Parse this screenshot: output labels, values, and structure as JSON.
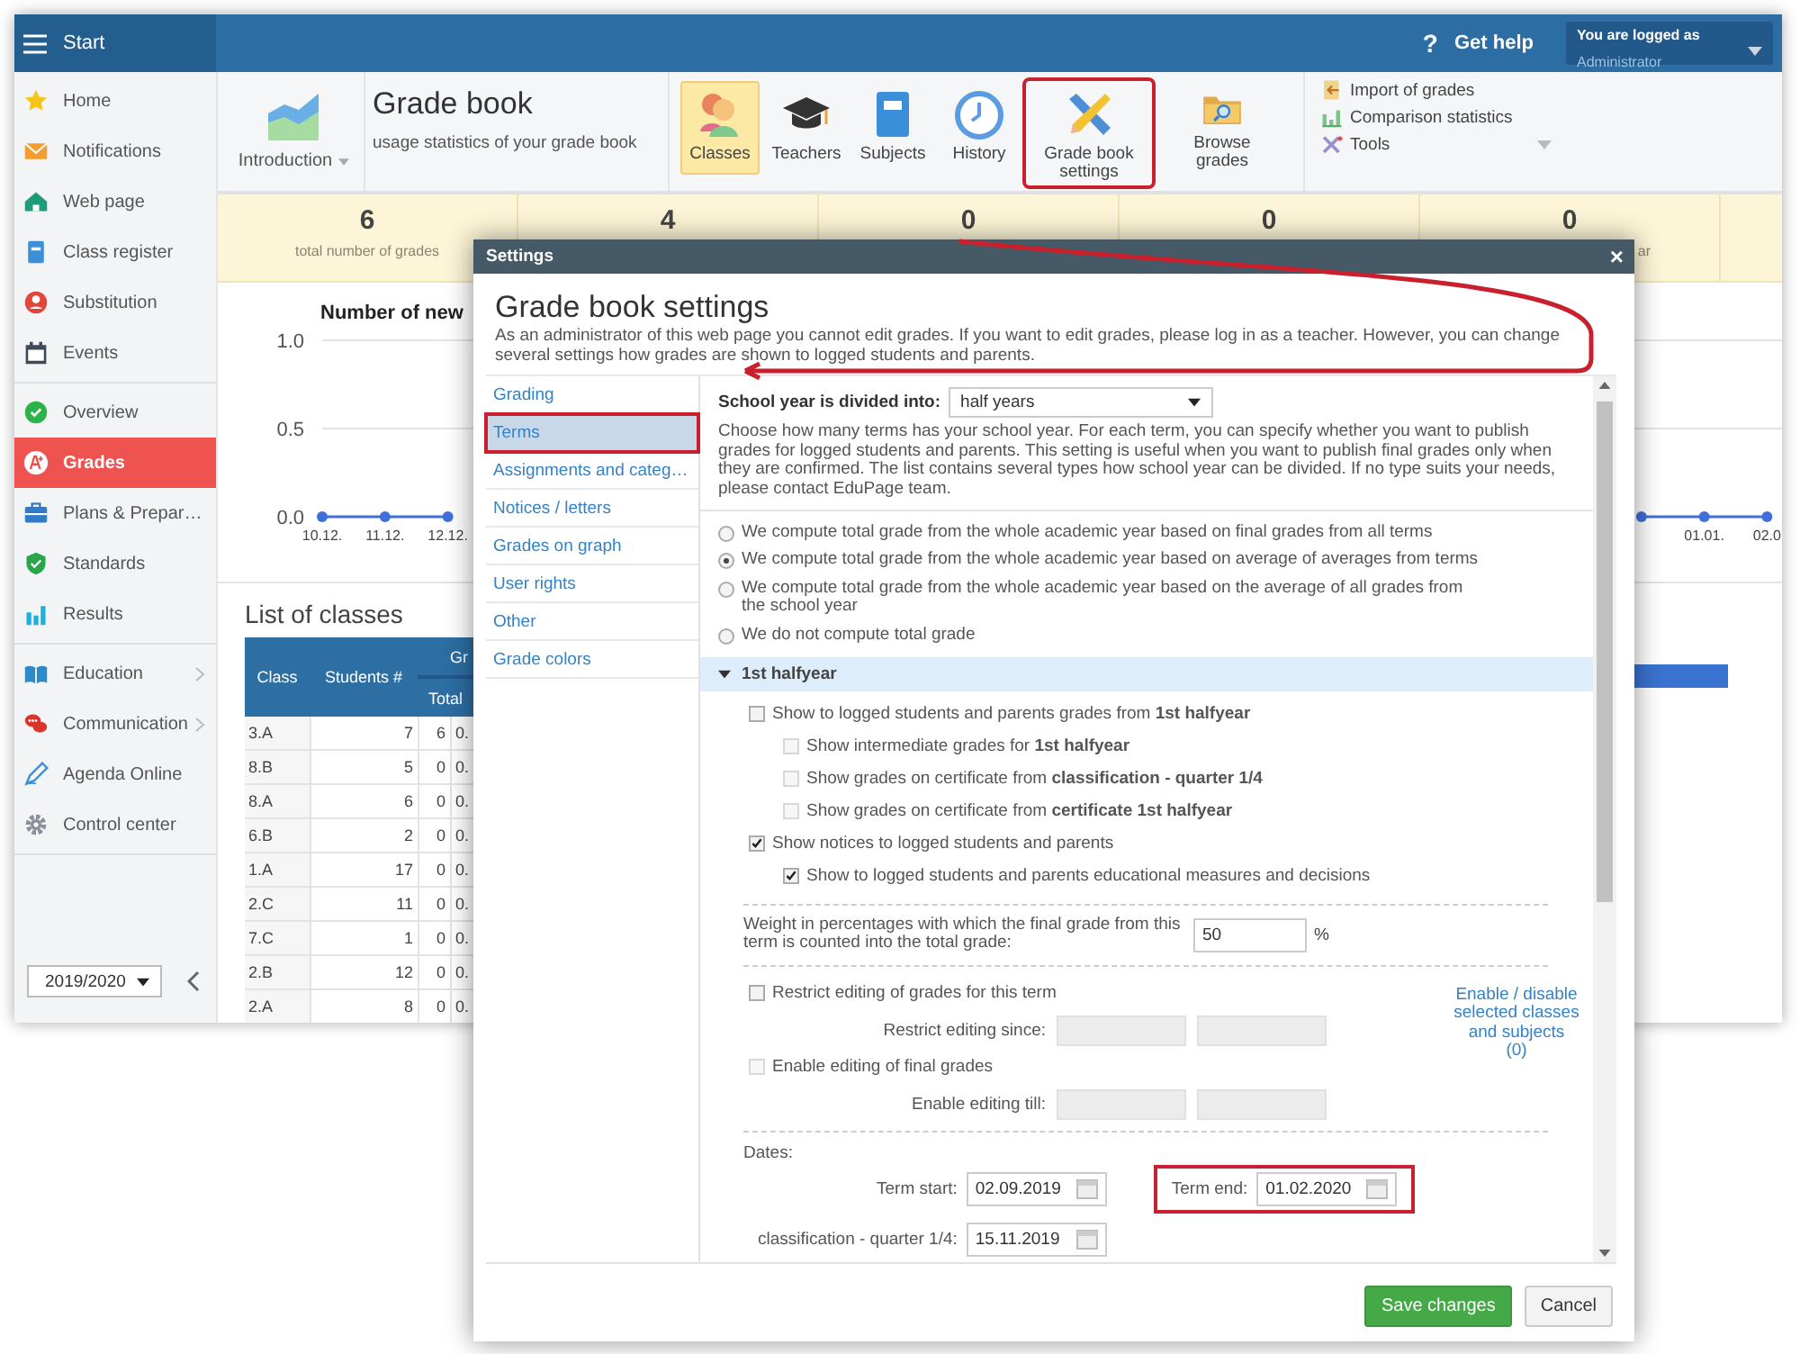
{
  "top_bar": {
    "menu_label": "Start",
    "help_icon": "?",
    "help": "Get help",
    "user": {
      "caption": "You are logged as",
      "name": "Administrator"
    }
  },
  "sidebar": {
    "groups": [
      [
        {
          "label": "Home",
          "selected": false,
          "has_submenu": false
        },
        {
          "label": "Notifications",
          "selected": false,
          "has_submenu": false
        },
        {
          "label": "Web page",
          "selected": false,
          "has_submenu": false
        },
        {
          "label": "Class register",
          "selected": false,
          "has_submenu": false
        },
        {
          "label": "Substitution",
          "selected": false,
          "has_submenu": false
        },
        {
          "label": "Events",
          "selected": false,
          "has_submenu": false
        }
      ],
      [
        {
          "label": "Overview",
          "selected": false,
          "has_submenu": false
        },
        {
          "label": "Grades",
          "selected": true,
          "has_submenu": false
        },
        {
          "label": "Plans & Prepar…",
          "selected": false,
          "has_submenu": false
        },
        {
          "label": "Standards",
          "selected": false,
          "has_submenu": false
        },
        {
          "label": "Results",
          "selected": false,
          "has_submenu": false
        }
      ],
      [
        {
          "label": "Education",
          "selected": false,
          "has_submenu": true
        },
        {
          "label": "Communication",
          "selected": false,
          "has_submenu": true
        },
        {
          "label": "Agenda Online",
          "selected": false,
          "has_submenu": false
        },
        {
          "label": "Control center",
          "selected": false,
          "has_submenu": false
        }
      ]
    ],
    "year": "2019/2020"
  },
  "toolbar": {
    "intro": "Introduction",
    "title": "Grade book",
    "subtitle": "usage statistics of your grade book",
    "buttons": [
      {
        "label": "Classes",
        "selected": true,
        "highlighted": false
      },
      {
        "label": "Teachers",
        "selected": false,
        "highlighted": false
      },
      {
        "label": "Subjects",
        "selected": false,
        "highlighted": false
      },
      {
        "label": "History",
        "selected": false,
        "highlighted": false
      },
      {
        "label": "Grade book settings",
        "selected": false,
        "highlighted": true
      },
      {
        "label": "Browse grades",
        "selected": false,
        "highlighted": false
      }
    ],
    "links": [
      "Import of grades",
      "Comparison statistics",
      "Tools"
    ]
  },
  "stats": [
    {
      "value": "6",
      "label": "total number of grades"
    },
    {
      "value": "4"
    },
    {
      "value": "0"
    },
    {
      "value": "0"
    },
    {
      "value": "0",
      "label": "ar"
    }
  ],
  "chart": {
    "chart_data": {
      "type": "line",
      "title": "Number of new",
      "categories": [
        "10.12.",
        "11.12.",
        "12.12.",
        null,
        null,
        null,
        null,
        null,
        null,
        null,
        null,
        null,
        null,
        null,
        null,
        null,
        null,
        null,
        null,
        null,
        null,
        null,
        "01.01.",
        "02.0"
      ],
      "values": [
        0,
        0,
        0,
        null,
        null,
        null,
        null,
        null,
        null,
        null,
        null,
        null,
        null,
        null,
        null,
        null,
        null,
        null,
        null,
        null,
        null,
        0,
        0,
        0
      ],
      "marker": "circle",
      "yticks": [
        {
          "value": 0,
          "label": "0.0"
        },
        {
          "value": 0.5,
          "label": "0.5"
        },
        {
          "value": 1,
          "label": "1.0"
        }
      ],
      "ylim": [
        0,
        1
      ]
    }
  },
  "class_list": {
    "title": "List of classes",
    "columns": [
      "Class",
      "Students #"
    ],
    "group_header": "Gr",
    "sub_header": "Total",
    "rows": [
      [
        "3.A",
        "7",
        "6",
        "0."
      ],
      [
        "8.B",
        "5",
        "0",
        "0."
      ],
      [
        "8.A",
        "6",
        "0",
        "0."
      ],
      [
        "6.B",
        "2",
        "0",
        "0."
      ],
      [
        "1.A",
        "17",
        "0",
        "0."
      ],
      [
        "2.C",
        "11",
        "0",
        "0."
      ],
      [
        "7.C",
        "1",
        "0",
        "0."
      ],
      [
        "2.B",
        "12",
        "0",
        "0."
      ],
      [
        "2.A",
        "8",
        "0",
        "0."
      ]
    ]
  },
  "dialog": {
    "window_title": "Settings",
    "close": "×",
    "title": "Grade book settings",
    "description": "As an administrator of this web page you cannot edit grades. If you want to edit grades, please log in as a teacher. However, you can change several settings how grades are shown to logged students and parents.",
    "nav": [
      {
        "label": "Grading",
        "selected": false,
        "highlighted": false
      },
      {
        "label": "Terms",
        "selected": true,
        "highlighted": true
      },
      {
        "label": "Assignments and categ…",
        "selected": false,
        "highlighted": false
      },
      {
        "label": "Notices / letters",
        "selected": false,
        "highlighted": false
      },
      {
        "label": "Grades on graph",
        "selected": false,
        "highlighted": false
      },
      {
        "label": "User rights",
        "selected": false,
        "highlighted": false
      },
      {
        "label": "Other",
        "selected": false,
        "highlighted": false
      },
      {
        "label": "Grade colors",
        "selected": false,
        "highlighted": false
      }
    ],
    "division_label": "School year is divided into:",
    "division_value": "half years",
    "division_help": "Choose how many terms has your school year. For each term, you can specify whether you want to publish grades for logged students and parents. This setting is useful when you want to publish final grades only when they are confirmed. The list contains several types how school year can be divided. If no type suits your needs, please contact EduPage team.",
    "total_grade_options": [
      {
        "label": "We compute total grade from the whole academic year based on final grades from all terms",
        "selected": false
      },
      {
        "label": "We compute total grade from the whole academic year based on average of averages from terms",
        "selected": true
      },
      {
        "label": "We compute total grade from the whole academic year based on the average of all grades from the school year",
        "selected": false
      },
      {
        "label": "We do not compute total grade",
        "selected": false
      }
    ],
    "term": {
      "title": "1st halfyear",
      "expanded": true,
      "publish_options": [
        {
          "label": "Show to logged students and parents grades from **1st halfyear**",
          "checked": false,
          "disabled": false,
          "children": [
            {
              "label": "Show intermediate grades for **1st halfyear**",
              "checked": false,
              "disabled": true
            },
            {
              "label": "Show grades on certificate from **classification - quarter 1/4**",
              "checked": false,
              "disabled": true
            },
            {
              "label": "Show grades on certificate from **certificate 1st halfyear**",
              "checked": false,
              "disabled": true
            }
          ]
        },
        {
          "label": "Show notices to logged students and parents",
          "checked": true,
          "disabled": false,
          "children": [
            {
              "label": "Show to logged students and parents educational measures and decisions",
              "checked": true,
              "disabled": false
            }
          ]
        }
      ],
      "weight_label": "Weight in percentages with which the final grade from this term is counted into the total grade:",
      "weight_value": "50",
      "weight_unit": "%",
      "restrict": [
        {
          "label": "Restrict editing of grades for this term",
          "checked": false,
          "disabled": false,
          "field_label": "Restrict editing since:"
        },
        {
          "label": "Enable editing of final grades",
          "checked": false,
          "disabled": true,
          "field_label": "Enable editing till:"
        }
      ],
      "classes_link": "Enable / disable selected classes and subjects",
      "classes_count": "(0)",
      "dates_label": "Dates:",
      "dates": [
        {
          "label": "Term start:",
          "value": "02.09.2019",
          "highlighted": false
        },
        {
          "label": "Term end:",
          "value": "01.02.2020",
          "highlighted": true
        },
        {
          "label": "classification - quarter 1/4:",
          "value": "15.11.2019",
          "highlighted": false
        }
      ]
    },
    "buttons": [
      {
        "label": "Save changes",
        "kind": "primary"
      },
      {
        "label": "Cancel",
        "kind": "secondary"
      }
    ]
  }
}
